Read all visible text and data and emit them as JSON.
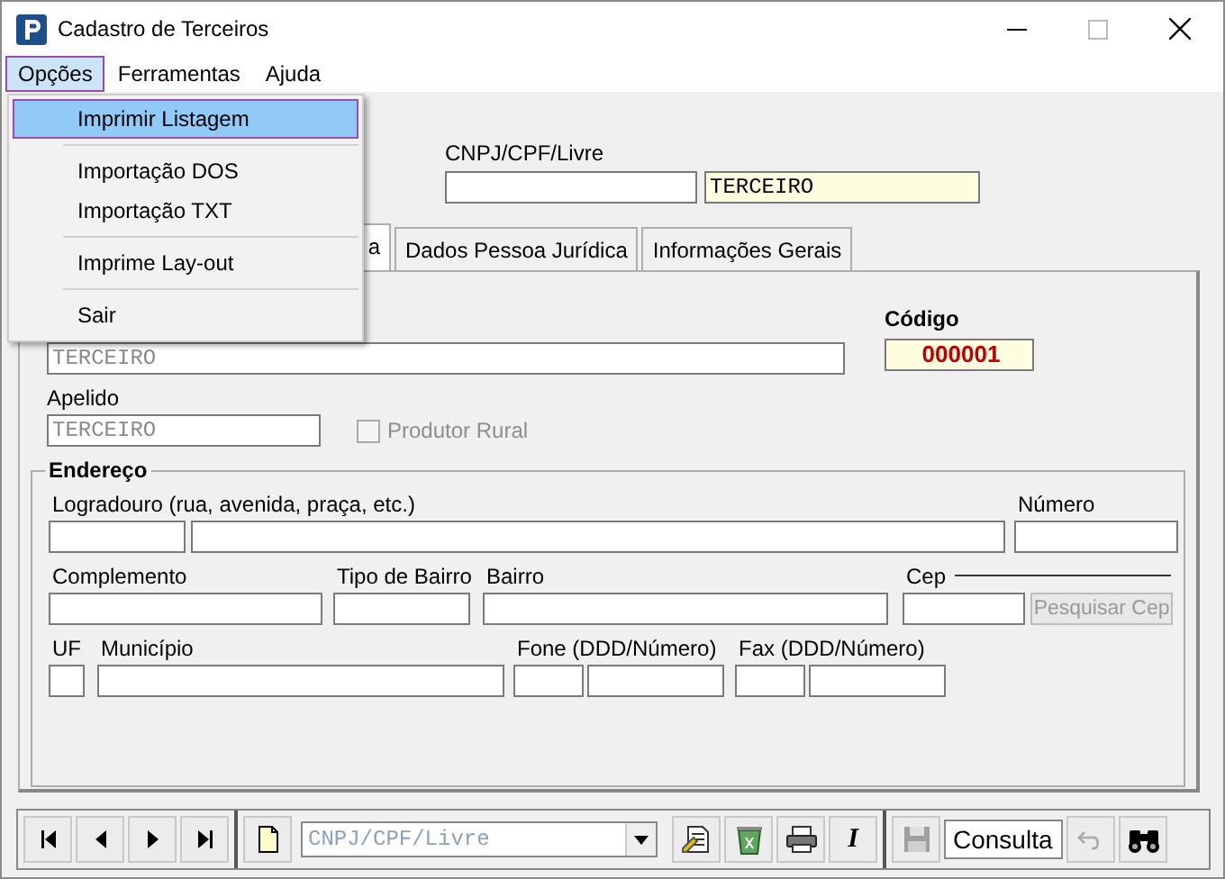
{
  "window": {
    "title": "Cadastro de Terceiros"
  },
  "menu_bar": [
    {
      "label": "Opções",
      "selected": true
    },
    {
      "label": "Ferramentas",
      "selected": false
    },
    {
      "label": "Ajuda",
      "selected": false
    }
  ],
  "open_menu": [
    {
      "kind": "item",
      "label": "Imprimir Listagem",
      "selected": true
    },
    {
      "kind": "separator"
    },
    {
      "kind": "item",
      "label": "Importação DOS",
      "selected": false
    },
    {
      "kind": "item",
      "label": "Importação TXT",
      "selected": false
    },
    {
      "kind": "separator"
    },
    {
      "kind": "item",
      "label": "Imprime Lay-out",
      "selected": false
    },
    {
      "kind": "separator"
    },
    {
      "kind": "item",
      "label": "Sair",
      "selected": false
    }
  ],
  "header": {
    "cnpj_label": "CNPJ/CPF/Livre",
    "type_value": "TERCEIRO"
  },
  "tabs": [
    {
      "label": "a",
      "selected": true
    },
    {
      "label": "Dados Pessoa Jurídica",
      "selected": false
    },
    {
      "label": "Informações Gerais",
      "selected": false
    }
  ],
  "name_value": "TERCEIRO",
  "codigo": {
    "label": "Código",
    "value": "000001"
  },
  "apelido": {
    "label": "Apelido",
    "value": "TERCEIRO"
  },
  "produtor_rural": {
    "label": "Produtor Rural",
    "checked": false,
    "disabled": true
  },
  "endereco": {
    "title": "Endereço",
    "fields": [
      {
        "label": "Logradouro (rua, avenida, praça, etc.)"
      },
      {
        "label": "Número"
      },
      {
        "label": "Complemento"
      },
      {
        "label": "Tipo de Bairro"
      },
      {
        "label": "Bairro"
      },
      {
        "label": "Cep",
        "button": {
          "label": "Pesquisar Cep",
          "disabled": true
        }
      },
      {
        "label": "UF"
      },
      {
        "label": "Município"
      },
      {
        "label": "Fone (DDD/Número)"
      },
      {
        "label": "Fax (DDD/Número)"
      }
    ]
  },
  "toolbar": {
    "nav": [
      {
        "kind": "first"
      },
      {
        "kind": "prev"
      },
      {
        "kind": "next"
      },
      {
        "kind": "last"
      }
    ],
    "search_combo": {
      "placeholder": "CNPJ/CPF/Livre"
    },
    "actions": [
      {
        "kind": "edit"
      },
      {
        "kind": "delete"
      },
      {
        "kind": "print"
      },
      {
        "kind": "text",
        "label": "I"
      }
    ],
    "save_disabled": true,
    "mode": "Consulta",
    "undo_disabled": true
  }
}
